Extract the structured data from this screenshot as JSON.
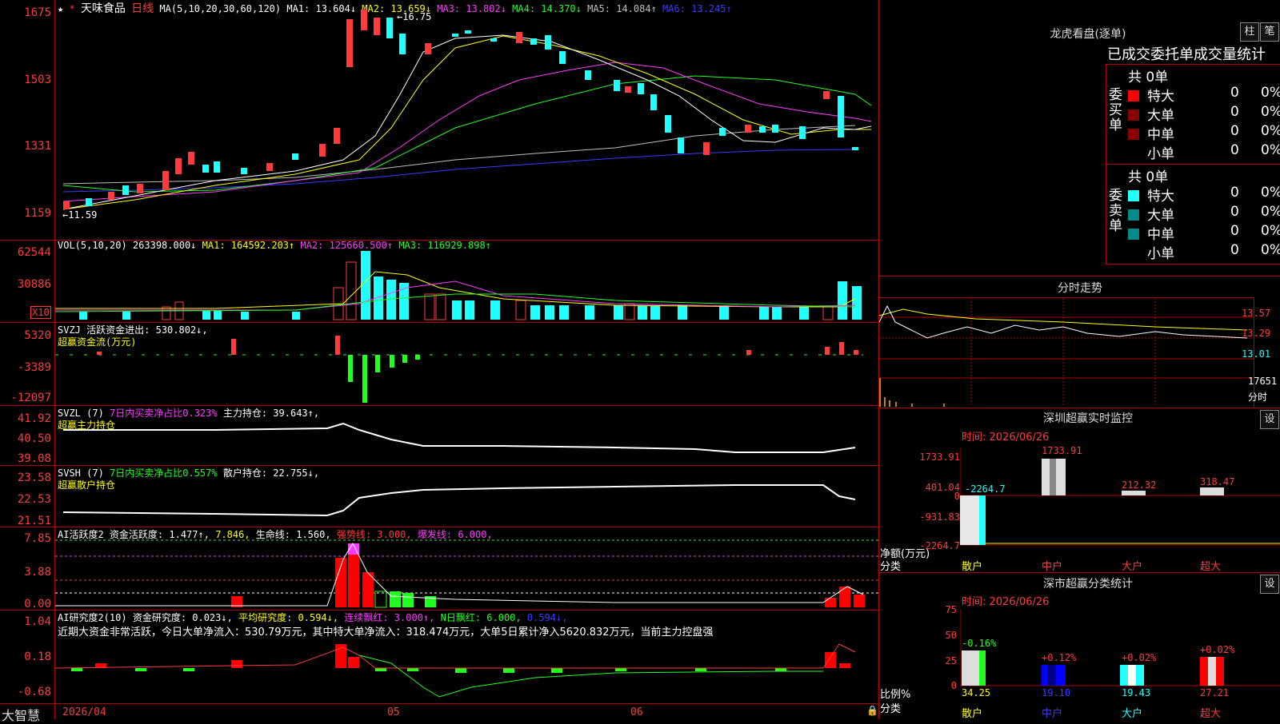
{
  "stock": {
    "name": "天味食品",
    "period": "日线"
  },
  "price_ma": {
    "label": "MA(5,10,20,30,60,120)",
    "ma1": "MA1: 13.604↓",
    "ma2": "MA2: 13.659↓",
    "ma3": "MA3: 13.802↓",
    "ma4": "MA4: 14.370↓",
    "ma5": "MA5: 14.084↑",
    "ma6": "MA6: 13.245↑",
    "high_mark": "16.75",
    "low_mark": "11.59",
    "yticks": [
      "1675",
      "1503",
      "1331",
      "1159"
    ]
  },
  "vol": {
    "label": "VOL(5,10,20)",
    "value": "263398.000↓",
    "ma1": "MA1: 164592.203↑",
    "ma2": "MA2: 125660.500↑",
    "ma3": "MA3: 116929.898↑",
    "yticks": [
      "62544",
      "30886"
    ],
    "unit": "X10"
  },
  "svzj": {
    "label": "SVZJ",
    "text": "活跃资金进出: 530.802↓,",
    "sub": "超赢资金流(万元)",
    "yticks": [
      "5320",
      "-3389",
      "-12097"
    ]
  },
  "svzl": {
    "label": "SVZL (7)",
    "text1": "7日内买卖净占比0.323%",
    "text2": "主力持仓: 39.643↑,",
    "sub": "超赢主力持仓",
    "yticks": [
      "41.92",
      "40.50",
      "39.08"
    ]
  },
  "svsh": {
    "label": "SVSH (7)",
    "text1": "7日内买卖净占比0.557%",
    "text2": "散户持仓: 22.755↓,",
    "sub": "超赢散户持仓",
    "yticks": [
      "23.58",
      "22.53",
      "21.51"
    ]
  },
  "ai_active": {
    "label": "AI活跃度2",
    "t1": "资金活跃度: 1.477↑,",
    "t2": "7.846,",
    "t3": "生命线: 1.560,",
    "t4": "强势线: 3.000,",
    "t5": "爆发线: 6.000,",
    "yticks": [
      "7.85",
      "3.88",
      "0.00"
    ]
  },
  "ai_research": {
    "label": "AI研究度2(10)",
    "t1": "资金研究度: 0.023↓,",
    "t2": "平均研究度: 0.594↓,",
    "t3": "连续飘红: 3.000↑,",
    "t4": "N日飘红: 6.000,",
    "t5": "0.594↓,",
    "comment": "近期大资金非常活跃，今日大单净流入：530.79万元，其中特大单净流入：318.474万元，大单5日累计净入5620.832万元，当前主力控盘强",
    "yticks": [
      "1.04",
      "0.18",
      "-0.68"
    ]
  },
  "bottom": {
    "brand": "大智慧",
    "date1": "2026/04",
    "date2": "05",
    "date3": "06"
  },
  "right": {
    "lhb_title": "龙虎看盘(逐单)",
    "btn_zhu": "柱",
    "btn_bi": "笔",
    "stats_title": "已成交委托单成交量统计",
    "buy_label": "委买单",
    "sell_label": "委卖单",
    "buy_total": "共 0单",
    "sell_total": "共 0单",
    "rows": [
      "特大",
      "大单",
      "中单",
      "小单"
    ],
    "zero": "0",
    "pct": "0%",
    "colors_buy": [
      "#ff0000",
      "#8b0000",
      "#8b0000",
      "#000000"
    ],
    "colors_sell": [
      "#21ffff",
      "#008b8b",
      "#008b8b",
      "#000000"
    ],
    "fenshi_title": "分时走势",
    "fenshi_prices": [
      "13.57",
      "13.29",
      "13.01"
    ],
    "fenshi_vol": [
      "17651",
      "分时"
    ],
    "mon_title": "深圳超赢实时监控",
    "btn_set": "设",
    "mon_time": "时间: 2026/06/26",
    "mon_yticks": [
      "1733.91",
      "401.04",
      "0",
      "-931.83",
      "-2264.7"
    ],
    "mon_left1": "净额(万元)",
    "mon_left2": "分类",
    "mon_vals": [
      "-2264.7",
      "1733.91",
      "212.32",
      "318.47"
    ],
    "mon_cats": [
      "散户",
      "中户",
      "大户",
      "超大"
    ],
    "cls_title": "深市超赢分类统计",
    "cls_time": "时间: 2026/06/26",
    "cls_yticks": [
      "75",
      "50",
      "25",
      "0"
    ],
    "cls_left1": "比例%",
    "cls_left2": "分类",
    "cls_pcts": [
      "-0.16%",
      "+0.12%",
      "+0.02%",
      "+0.02%"
    ],
    "cls_vals": [
      "34.25",
      "19.10",
      "19.43",
      "27.21"
    ],
    "cls_cats": [
      "散户",
      "中户",
      "大户",
      "超大"
    ]
  }
}
